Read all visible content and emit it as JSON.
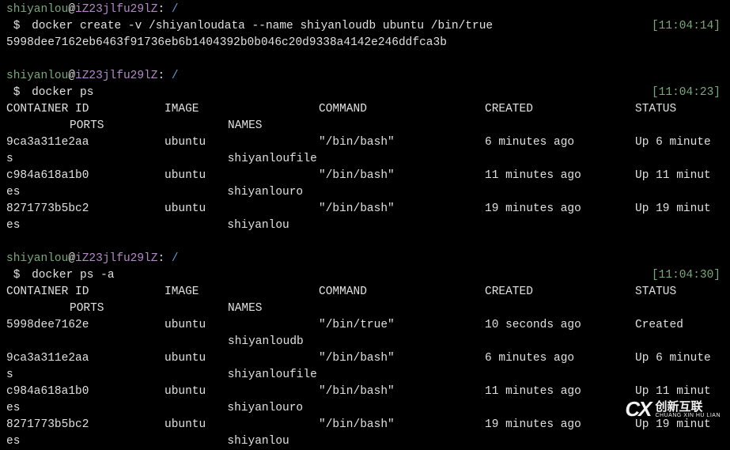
{
  "prompt": {
    "user": "shiyanlou",
    "at": "@",
    "host": "iZ23jlfu29lZ",
    "colon": ":",
    "path": " /",
    "dollar": " $ "
  },
  "block1": {
    "cmd": "docker create -v /shiyanloudata --name shiyanloudb ubuntu /bin/true",
    "ts": "[11:04:14]",
    "output": "5998dee7162eb6463f91736eb6b1404392b0b046c20d9338a4142e246ddfca3b"
  },
  "block2": {
    "cmd": "docker ps",
    "ts": "[11:04:23]",
    "headers": {
      "cid": "CONTAINER ID",
      "img": "IMAGE",
      "cmd": "COMMAND",
      "crt": "CREATED",
      "sts": "STATUS",
      "prt": "PORTS",
      "nam": "NAMES"
    },
    "rows": [
      {
        "cid": "9ca3a311e2aa",
        "img": "ubuntu",
        "cmd": "\"/bin/bash\"",
        "crt": "6 minutes ago",
        "sts": "Up 6 minute",
        "suffix": "s",
        "nam": "shiyanloufile"
      },
      {
        "cid": "c984a618a1b0",
        "img": "ubuntu",
        "cmd": "\"/bin/bash\"",
        "crt": "11 minutes ago",
        "sts": "Up 11 minut",
        "suffix": "es",
        "nam": "shiyanlouro"
      },
      {
        "cid": "8271773b5bc2",
        "img": "ubuntu",
        "cmd": "\"/bin/bash\"",
        "crt": "19 minutes ago",
        "sts": "Up 19 minut",
        "suffix": "es",
        "nam": "shiyanlou"
      }
    ]
  },
  "block3": {
    "cmd": "docker ps -a",
    "ts": "[11:04:30]",
    "headers": {
      "cid": "CONTAINER ID",
      "img": "IMAGE",
      "cmd": "COMMAND",
      "crt": "CREATED",
      "sts": "STATUS",
      "prt": "PORTS",
      "nam": "NAMES"
    },
    "rows": [
      {
        "cid": "5998dee7162e",
        "img": "ubuntu",
        "cmd": "\"/bin/true\"",
        "crt": "10 seconds ago",
        "sts": "Created",
        "suffix": "",
        "nam": "shiyanloudb"
      },
      {
        "cid": "9ca3a311e2aa",
        "img": "ubuntu",
        "cmd": "\"/bin/bash\"",
        "crt": "6 minutes ago",
        "sts": "Up 6 minute",
        "suffix": "s",
        "nam": "shiyanloufile"
      },
      {
        "cid": "c984a618a1b0",
        "img": "ubuntu",
        "cmd": "\"/bin/bash\"",
        "crt": "11 minutes ago",
        "sts": "Up 11 minut",
        "suffix": "es",
        "nam": "shiyanlouro"
      },
      {
        "cid": "8271773b5bc2",
        "img": "ubuntu",
        "cmd": "\"/bin/bash\"",
        "crt": "19 minutes ago",
        "sts": "Up 19 minut",
        "suffix": "es",
        "nam": "shiyanlou"
      }
    ]
  },
  "watermark": {
    "logo": "CX",
    "cn": "创新互联",
    "py": "CHUANG XIN HU LIAN"
  }
}
